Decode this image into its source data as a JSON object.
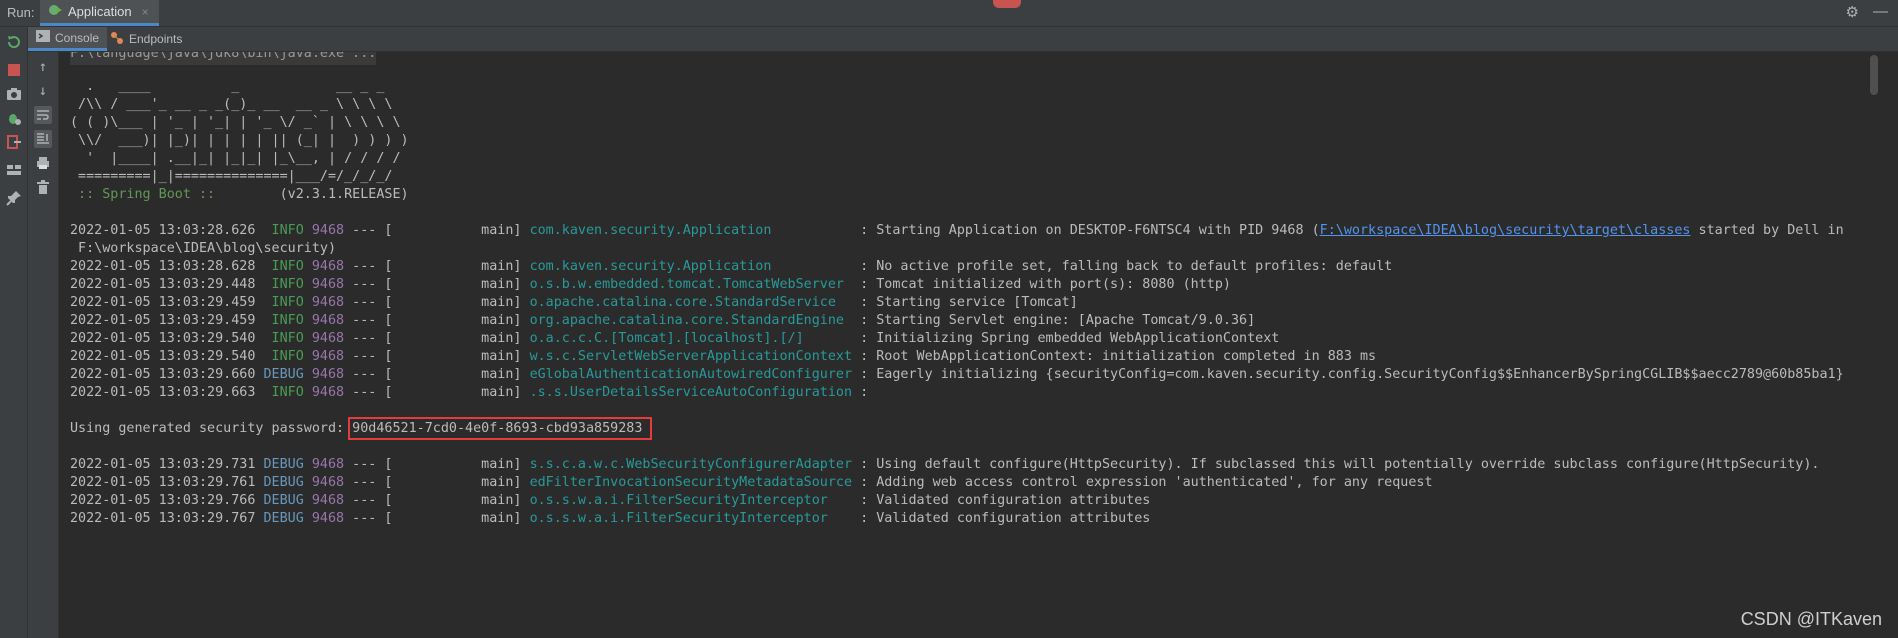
{
  "titlebar": {
    "run_label": "Run:",
    "tab_label": "Application",
    "tab_close": "×",
    "settings_icon": "⚙",
    "minimize_icon": "—"
  },
  "subtabs": [
    {
      "label": "Console"
    },
    {
      "label": "Endpoints"
    }
  ],
  "console": {
    "cmd": "F:\\language\\java\\jdk8\\bin\\java.exe ...",
    "banner": [
      "  .   ____          _            __ _ _",
      " /\\\\ / ___'_ __ _ _(_)_ __  __ _ \\ \\ \\ \\",
      "( ( )\\___ | '_ | '_| | '_ \\/ _` | \\ \\ \\ \\",
      " \\\\/  ___)| |_)| | | | | || (_| |  ) ) ) )",
      "  '  |____| .__|_| |_|_| |_\\__, | / / / /",
      " =========|_|==============|___/=/_/_/_/"
    ],
    "spring_label": " :: Spring Boot :: ",
    "spring_version": "       (v2.3.1.RELEASE)",
    "logs1": [
      {
        "ts": "2022-01-05 13:03:28.626",
        "level": " INFO",
        "pid": "9468",
        "sep": " --- [           main] ",
        "logger": "com.kaven.security.Application          ",
        "msg_pre": " : Starting Application on DESKTOP-F6NTSC4 with PID 9468 (",
        "link": "F:\\workspace\\IDEA\\blog\\security\\target\\classes",
        "msg_post": " started by Dell in"
      },
      {
        "ts": "2022-01-05 13:03:28.628",
        "level": " INFO",
        "pid": "9468",
        "sep": " --- [           main] ",
        "logger": "com.kaven.security.Application          ",
        "msg": " : No active profile set, falling back to default profiles: default"
      },
      {
        "ts": "2022-01-05 13:03:29.448",
        "level": " INFO",
        "pid": "9468",
        "sep": " --- [           main] ",
        "logger": "o.s.b.w.embedded.tomcat.TomcatWebServer ",
        "msg": " : Tomcat initialized with port(s): 8080 (http)"
      },
      {
        "ts": "2022-01-05 13:03:29.459",
        "level": " INFO",
        "pid": "9468",
        "sep": " --- [           main] ",
        "logger": "o.apache.catalina.core.StandardService  ",
        "msg": " : Starting service [Tomcat]"
      },
      {
        "ts": "2022-01-05 13:03:29.459",
        "level": " INFO",
        "pid": "9468",
        "sep": " --- [           main] ",
        "logger": "org.apache.catalina.core.StandardEngine ",
        "msg": " : Starting Servlet engine: [Apache Tomcat/9.0.36]"
      },
      {
        "ts": "2022-01-05 13:03:29.540",
        "level": " INFO",
        "pid": "9468",
        "sep": " --- [           main] ",
        "logger": "o.a.c.c.C.[Tomcat].[localhost].[/]      ",
        "msg": " : Initializing Spring embedded WebApplicationContext"
      },
      {
        "ts": "2022-01-05 13:03:29.540",
        "level": " INFO",
        "pid": "9468",
        "sep": " --- [           main] ",
        "logger": "w.s.c.ServletWebServerApplicationContext",
        "msg": " : Root WebApplicationContext: initialization completed in 883 ms"
      },
      {
        "ts": "2022-01-05 13:03:29.660",
        "level": "DEBUG",
        "pid": "9468",
        "sep": " --- [           main] ",
        "logger": "eGlobalAuthenticationAutowiredConfigurer",
        "msg": " : Eagerly initializing {securityConfig=com.kaven.security.config.SecurityConfig$$EnhancerBySpringCGLIB$$aecc2789@60b85ba1}"
      },
      {
        "ts": "2022-01-05 13:03:29.663",
        "level": " INFO",
        "pid": "9468",
        "sep": " --- [           main] ",
        "logger": ".s.s.UserDetailsServiceAutoConfiguration",
        "msg": " :"
      }
    ],
    "wrap_line": " F:\\workspace\\IDEA\\blog\\security)",
    "password_label": "Using generated security password: ",
    "password_value": "90d46521-7cd0-4e0f-8693-cbd93a859283",
    "logs2": [
      {
        "ts": "2022-01-05 13:03:29.731",
        "level": "DEBUG",
        "pid": "9468",
        "sep": " --- [           main] ",
        "logger": "s.s.c.a.w.c.WebSecurityConfigurerAdapter",
        "msg": " : Using default configure(HttpSecurity). If subclassed this will potentially override subclass configure(HttpSecurity)."
      },
      {
        "ts": "2022-01-05 13:03:29.761",
        "level": "DEBUG",
        "pid": "9468",
        "sep": " --- [           main] ",
        "logger": "edFilterInvocationSecurityMetadataSource",
        "msg": " : Adding web access control expression 'authenticated', for any request"
      },
      {
        "ts": "2022-01-05 13:03:29.766",
        "level": "DEBUG",
        "pid": "9468",
        "sep": " --- [           main] ",
        "logger": "o.s.s.w.a.i.FilterSecurityInterceptor   ",
        "msg": " : Validated configuration attributes"
      },
      {
        "ts": "2022-01-05 13:03:29.767",
        "level": "DEBUG",
        "pid": "9468",
        "sep": " --- [           main] ",
        "logger": "o.s.s.w.a.i.FilterSecurityInterceptor   ",
        "msg": " : Validated configuration attributes"
      }
    ]
  },
  "watermark": "CSDN @ITKaven",
  "colors": {
    "info": "#499c54",
    "debug": "#6897bb",
    "pid": "#9876aa",
    "logger": "#299999",
    "highlight": "#e23c3c"
  }
}
